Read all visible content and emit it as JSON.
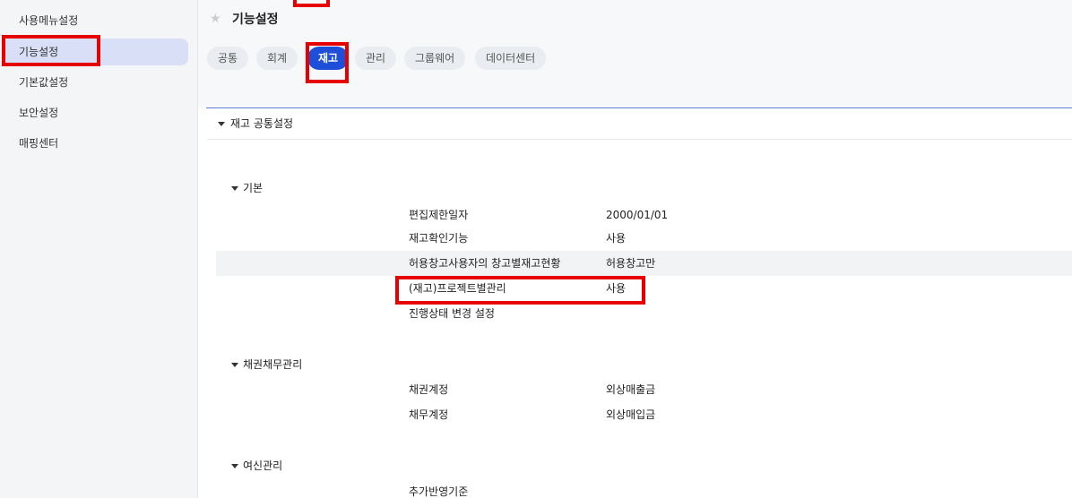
{
  "sidebar": {
    "items": [
      {
        "label": "사용메뉴설정"
      },
      {
        "label": "기능설정"
      },
      {
        "label": "기본값설정"
      },
      {
        "label": "보안설정"
      },
      {
        "label": "매핑센터"
      }
    ]
  },
  "header": {
    "title": "기능설정",
    "tabs": [
      {
        "label": "공통"
      },
      {
        "label": "회계"
      },
      {
        "label": "재고"
      },
      {
        "label": "관리"
      },
      {
        "label": "그룹웨어"
      },
      {
        "label": "데이터센터"
      }
    ],
    "active_tab": "재고"
  },
  "section": {
    "title": "재고 공통설정",
    "groups": [
      {
        "title": "기본",
        "rows": [
          {
            "label": "편집제한일자",
            "value": "2000/01/01"
          },
          {
            "label": "재고확인기능",
            "value": "사용"
          },
          {
            "label": "허용창고사용자의 창고별재고현황",
            "value": "허용창고만"
          },
          {
            "label": "(재고)프로젝트별관리",
            "value": "사용"
          },
          {
            "label": "진행상태 변경 설정",
            "value": ""
          }
        ]
      },
      {
        "title": "채권채무관리",
        "rows": [
          {
            "label": "채권계정",
            "value": "외상매출금"
          },
          {
            "label": "채무계정",
            "value": "외상매입금"
          }
        ]
      },
      {
        "title": "여신관리",
        "rows": [
          {
            "label": "추가반영기준",
            "value": ""
          }
        ]
      }
    ]
  },
  "colors": {
    "accent": "#1e4fd8",
    "highlight": "#e60000",
    "active_sidebar": "#d8dff7"
  },
  "icons": {
    "favorite": "star-icon",
    "collapse": "caret-down-icon"
  }
}
